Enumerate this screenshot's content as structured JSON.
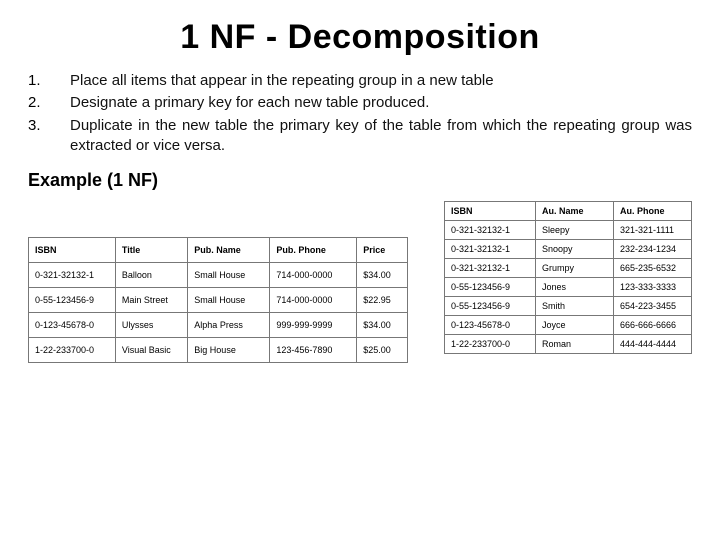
{
  "title": "1 NF - Decomposition",
  "steps": [
    {
      "num": "1.",
      "text": "Place all items that appear in the repeating group in a new table"
    },
    {
      "num": "2.",
      "text": "Designate a primary key for each new table produced."
    },
    {
      "num": "3.",
      "text": "Duplicate in the new table the primary key of the table from which the repeating group was extracted or vice versa."
    }
  ],
  "example_label": "Example (1 NF)",
  "left_table": {
    "headers": [
      "ISBN",
      "Title",
      "Pub. Name",
      "Pub. Phone",
      "Price"
    ],
    "rows": [
      [
        "0-321-32132-1",
        "Balloon",
        "Small House",
        "714-000-0000",
        "$34.00"
      ],
      [
        "0-55-123456-9",
        "Main Street",
        "Small House",
        "714-000-0000",
        "$22.95"
      ],
      [
        "0-123-45678-0",
        "Ulysses",
        "Alpha Press",
        "999-999-9999",
        "$34.00"
      ],
      [
        "1-22-233700-0",
        "Visual Basic",
        "Big House",
        "123-456-7890",
        "$25.00"
      ]
    ]
  },
  "right_table": {
    "headers": [
      "ISBN",
      "Au. Name",
      "Au. Phone"
    ],
    "rows": [
      [
        "0-321-32132-1",
        "Sleepy",
        "321-321-1111"
      ],
      [
        "0-321-32132-1",
        "Snoopy",
        "232-234-1234"
      ],
      [
        "0-321-32132-1",
        "Grumpy",
        "665-235-6532"
      ],
      [
        "0-55-123456-9",
        "Jones",
        "123-333-3333"
      ],
      [
        "0-55-123456-9",
        "Smith",
        "654-223-3455"
      ],
      [
        "0-123-45678-0",
        "Joyce",
        "666-666-6666"
      ],
      [
        "1-22-233700-0",
        "Roman",
        "444-444-4444"
      ]
    ]
  }
}
